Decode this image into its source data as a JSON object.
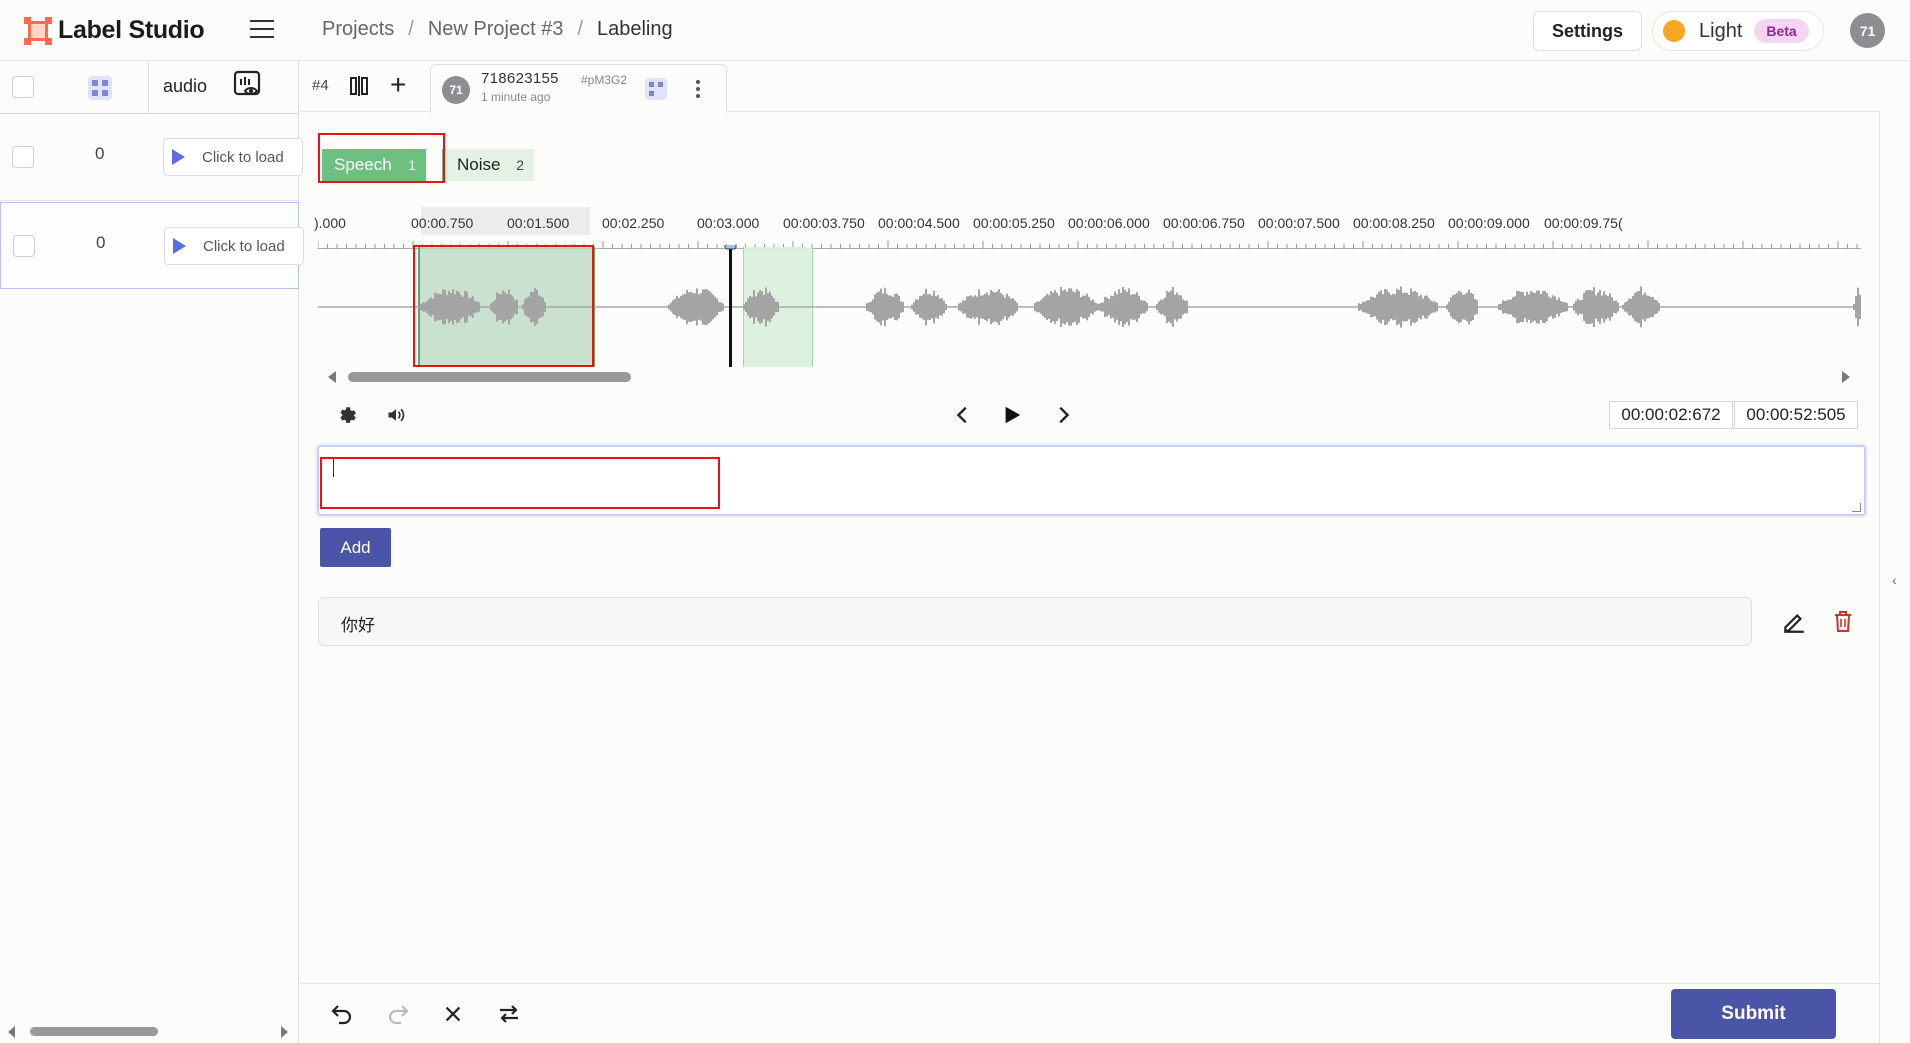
{
  "header": {
    "logo_text": "Label Studio",
    "breadcrumb": [
      "Projects",
      "New Project #3",
      "Labeling"
    ],
    "separator": "/",
    "settings_label": "Settings",
    "theme_label": "Light",
    "beta_label": "Beta",
    "user_initials": "71"
  },
  "data_manager": {
    "column_header": "audio",
    "rows": [
      {
        "id_value": "0",
        "load_label": "Click to load",
        "selected": false
      },
      {
        "id_value": "0",
        "load_label": "Click to load",
        "selected": true
      }
    ]
  },
  "annotation_tabs": {
    "task_number": "#4",
    "add_symbol": "+",
    "active": {
      "avatar": "71",
      "id": "718623155",
      "hash": "#pM3G2",
      "time": "1 minute ago"
    }
  },
  "labels": [
    {
      "name": "Speech",
      "hotkey": "1",
      "color": "#6dc07f"
    },
    {
      "name": "Noise",
      "hotkey": "2",
      "color": "#6dc07f"
    }
  ],
  "timeline": {
    "ticks": [
      ").000",
      "00:00.750",
      "00:01.500",
      "00:02.250",
      "00:03.000",
      "00:00:03.750",
      "00:00:04.500",
      "00:00:05.250",
      "00:00:06.000",
      "00:00:06.750",
      "00:00:07.500",
      "00:00:08.250",
      "00:00:09.000",
      "00:00:09.75("
    ]
  },
  "player": {
    "current_time": "00:00:02:672",
    "duration": "00:00:52:505"
  },
  "transcription": {
    "input_value": "",
    "add_label": "Add",
    "results": [
      "你好"
    ]
  },
  "footer": {
    "submit_label": "Submit"
  },
  "colors": {
    "accent": "#4a55a8",
    "speech": "#6dc07f",
    "region": "#b7d9c0",
    "highlight": "#e11111"
  }
}
